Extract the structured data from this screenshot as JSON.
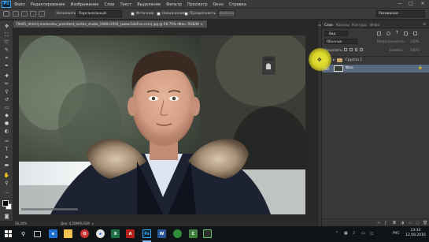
{
  "app": {
    "logo": "Ps"
  },
  "menu": {
    "items": [
      "Файл",
      "Редактирование",
      "Изображение",
      "Слои",
      "Текст",
      "Выделение",
      "Фильтр",
      "Просмотр",
      "Окно",
      "Справка"
    ],
    "minimize": "—",
    "maximize": "□",
    "close": "✕"
  },
  "options_bar": {
    "sample_label": "Заполнить:",
    "sample_value": "Порганальный",
    "chk1_label": "Источник",
    "chk2_label": "Назначение",
    "chk3_label": "Прозрачность",
    "chk4_label": "Шаблон",
    "right_dropdown": "Рисование"
  },
  "document": {
    "tab_title": "79445_dmitrij-medvedev_prezident_kurtka_shuba_1680x1050_(www.GdeFon.com).jpg @ 56,75% (Фон, RGB/8) ×",
    "zoom": "56,44%",
    "doc_info": "Док: 4,50М/9,01М"
  },
  "panels": {
    "tabs": [
      "Слои",
      "Каналы",
      "Контуры",
      "Инфо"
    ],
    "kind_label": "Вид",
    "blend_mode": "Обычные",
    "opacity_label": "Непрозрачность:",
    "opacity_value": "100%",
    "lock_label": "Закрепить:",
    "fill_label": "Заливка:",
    "fill_value": "100%",
    "layers": [
      {
        "name": "Группа 1",
        "type": "group"
      },
      {
        "name": "Фон",
        "type": "background"
      }
    ]
  },
  "taskbar": {
    "app_labels": {
      "excel": "X",
      "acrobat": "A",
      "photoshop": "Ps",
      "word": "W",
      "camtasia": "C"
    },
    "lang": "РУС",
    "time": "13:33",
    "date": "12.08.2016"
  }
}
